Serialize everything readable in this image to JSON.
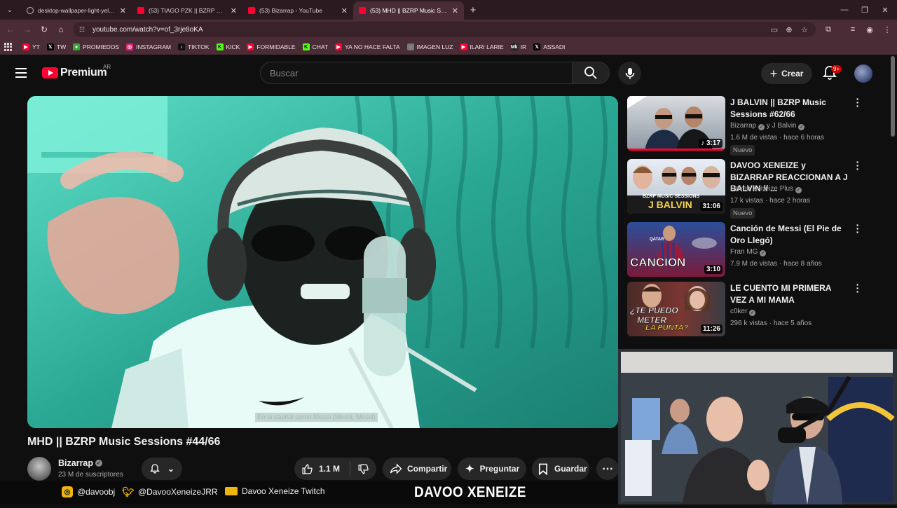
{
  "browser": {
    "tabs": [
      {
        "title": "desktop-wallpaper-light-yellow",
        "icon": "globe-icon",
        "active": false
      },
      {
        "title": "(53) TIAGO PZK || BZRP Music S",
        "icon": "youtube-icon",
        "active": false
      },
      {
        "title": "(53) Bizarrap - YouTube",
        "icon": "youtube-icon",
        "active": false
      },
      {
        "title": "(53) MHD || BZRP Music Session",
        "icon": "youtube-icon",
        "active": true
      }
    ],
    "url": "youtube.com/watch?v=of_3rje8oKA",
    "bookmarks": [
      {
        "label": "YT",
        "icon": "youtube-icon",
        "color": "#ff0033"
      },
      {
        "label": "TW",
        "icon": "x-icon",
        "color": "#000000"
      },
      {
        "label": "PROMIEDOS",
        "icon": "soccer-icon",
        "color": "#3aa53a"
      },
      {
        "label": "INSTAGRAM",
        "icon": "instagram-icon",
        "color": "#d62976"
      },
      {
        "label": "TIKTOK",
        "icon": "tiktok-icon",
        "color": "#111111"
      },
      {
        "label": "KICK",
        "icon": "kick-icon",
        "color": "#53fc18"
      },
      {
        "label": "FORMIDABLE",
        "icon": "youtube-icon",
        "color": "#ff0033"
      },
      {
        "label": "CHAT",
        "icon": "kick-icon",
        "color": "#53fc18"
      },
      {
        "label": "YA NO HACE FALTA",
        "icon": "youtube-icon",
        "color": "#ff0033"
      },
      {
        "label": "IMAGEN LUZ",
        "icon": "globe-icon",
        "color": "#777777"
      },
      {
        "label": "ILARI LARIE",
        "icon": "youtube-icon",
        "color": "#ff0033"
      },
      {
        "label": "IR",
        "icon": "mk-icon",
        "color": "#222222"
      },
      {
        "label": "ASSADI",
        "icon": "x-icon",
        "color": "#000000"
      }
    ]
  },
  "header": {
    "logo_text": "Premium",
    "region": "AR",
    "search_placeholder": "Buscar",
    "create_label": "Crear",
    "notifications_badge": "9+"
  },
  "video": {
    "title": "MHD || BZRP Music Sessions #44/66",
    "caption": "En la capital como Messi (Messi, Messi)",
    "channel": "Bizarrap",
    "subscribers": "23 M de suscriptores",
    "likes": "1.1 M",
    "share_label": "Compartir",
    "ask_label": "Preguntar",
    "save_label": "Guardar"
  },
  "recommendations": [
    {
      "title": "J BALVIN || BZRP Music Sessions #62/66",
      "channel": "Bizarrap",
      "channel_suffix": "y J Balvin",
      "meta": "1.6 M de vistas · hace 6 horas",
      "badge": "Nuevo",
      "duration": "3:17"
    },
    {
      "title": "DAVOO XENEIZE y BIZARRAP REACCIONAN A J BALVIN // ...",
      "channel": "Davoo Xeneize Plus",
      "channel_suffix": "",
      "meta": "17 k vistas · hace 2 horas",
      "badge": "Nuevo",
      "duration": "31:06",
      "thumb_text": "BZRP MUSIC SESSIONS",
      "thumb_text2": "J BALVIN"
    },
    {
      "title": "Canción de Messi (El Pie de Oro Llegó)",
      "channel": "Fran MG",
      "channel_suffix": "",
      "meta": "7.9 M de vistas · hace 8 años",
      "badge": "",
      "duration": "3:10",
      "thumb_text": "CANCION",
      "thumb_text2": "QATAR"
    },
    {
      "title": "LE CUENTO MI PRIMERA VEZ A MI MAMA",
      "channel": "c0ker",
      "channel_suffix": "",
      "meta": "296 k vistas · hace 5 años",
      "badge": "",
      "duration": "11:26",
      "thumb_text": "¿TE PUEDO",
      "thumb_text2": "METER",
      "thumb_text3": "LA PUNTA?"
    }
  ],
  "stream_banner": {
    "instagram": "@davoobj",
    "twitter": "@DavooXeneizeJRR",
    "twitch": "Davoo Xeneize Twitch",
    "brand": "DAVOO XENEIZE"
  },
  "colors": {
    "youtube_red": "#ff0033",
    "browser_frame": "#4a2c36",
    "page_bg": "#0f0f0f"
  }
}
